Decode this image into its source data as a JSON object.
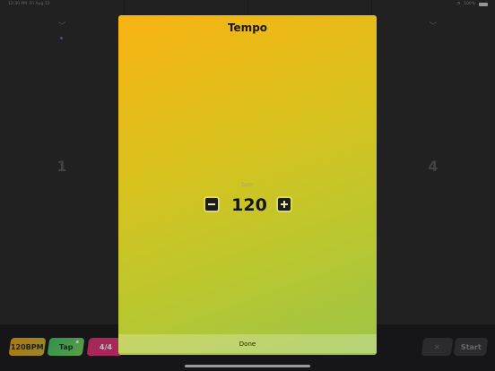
{
  "status_bar": {
    "time": "12:30 PM",
    "date": "Fri Aug 12",
    "battery": "100%"
  },
  "columns": {
    "first_number": "1",
    "last_number": "4"
  },
  "bottom_bar": {
    "bpm_label": "120BPM",
    "tap_label": "Tap",
    "signature_label": "4/4",
    "start_label": "Start"
  },
  "modal": {
    "title": "Tempo",
    "unit_label": "bpm",
    "value": "120",
    "done_label": "Done"
  },
  "colors": {
    "modal_gradient_start": "#f9b312",
    "modal_gradient_end": "#9cc64a",
    "tap_green": "#3fc36d",
    "signature_pink": "#e0357a"
  },
  "icons": [
    "minus-icon",
    "plus-icon",
    "chevron-down-icon",
    "mute-icon",
    "battery-icon",
    "wifi-icon"
  ]
}
